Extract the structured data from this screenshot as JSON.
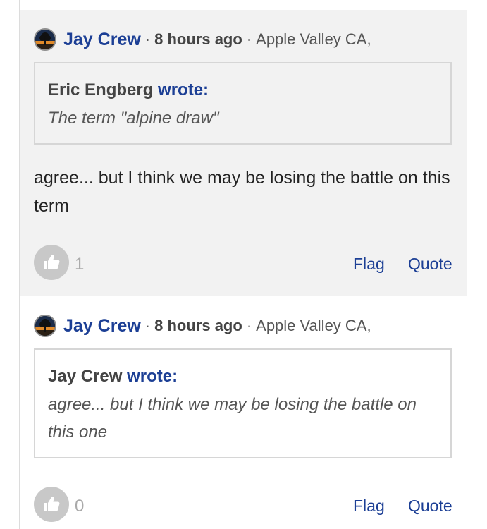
{
  "comments": [
    {
      "author": "Jay Crew",
      "time": "8 hours ago",
      "location": "Apple Valley CA,",
      "quote": {
        "author": "Eric Engberg",
        "wrote": "wrote:",
        "text": "The term \"alpine draw\""
      },
      "body": "agree... but I think we may be losing the battle on this term",
      "likes": "1",
      "flag_label": "Flag",
      "quote_label": "Quote"
    },
    {
      "author": "Jay Crew",
      "time": "8 hours ago",
      "location": "Apple Valley CA,",
      "quote": {
        "author": "Jay Crew",
        "wrote": "wrote:",
        "text": "agree... but I think we may be losing the battle on this one"
      },
      "likes": "0",
      "flag_label": "Flag",
      "quote_label": "Quote"
    }
  ],
  "separator": "·",
  "icons": {
    "like": "thumbs-up-icon",
    "avatar": "tree-sunset-avatar"
  },
  "colors": {
    "link": "#1c3f95",
    "highlight_bg": "#f2f2f2",
    "like_button": "#c8c8c8"
  }
}
